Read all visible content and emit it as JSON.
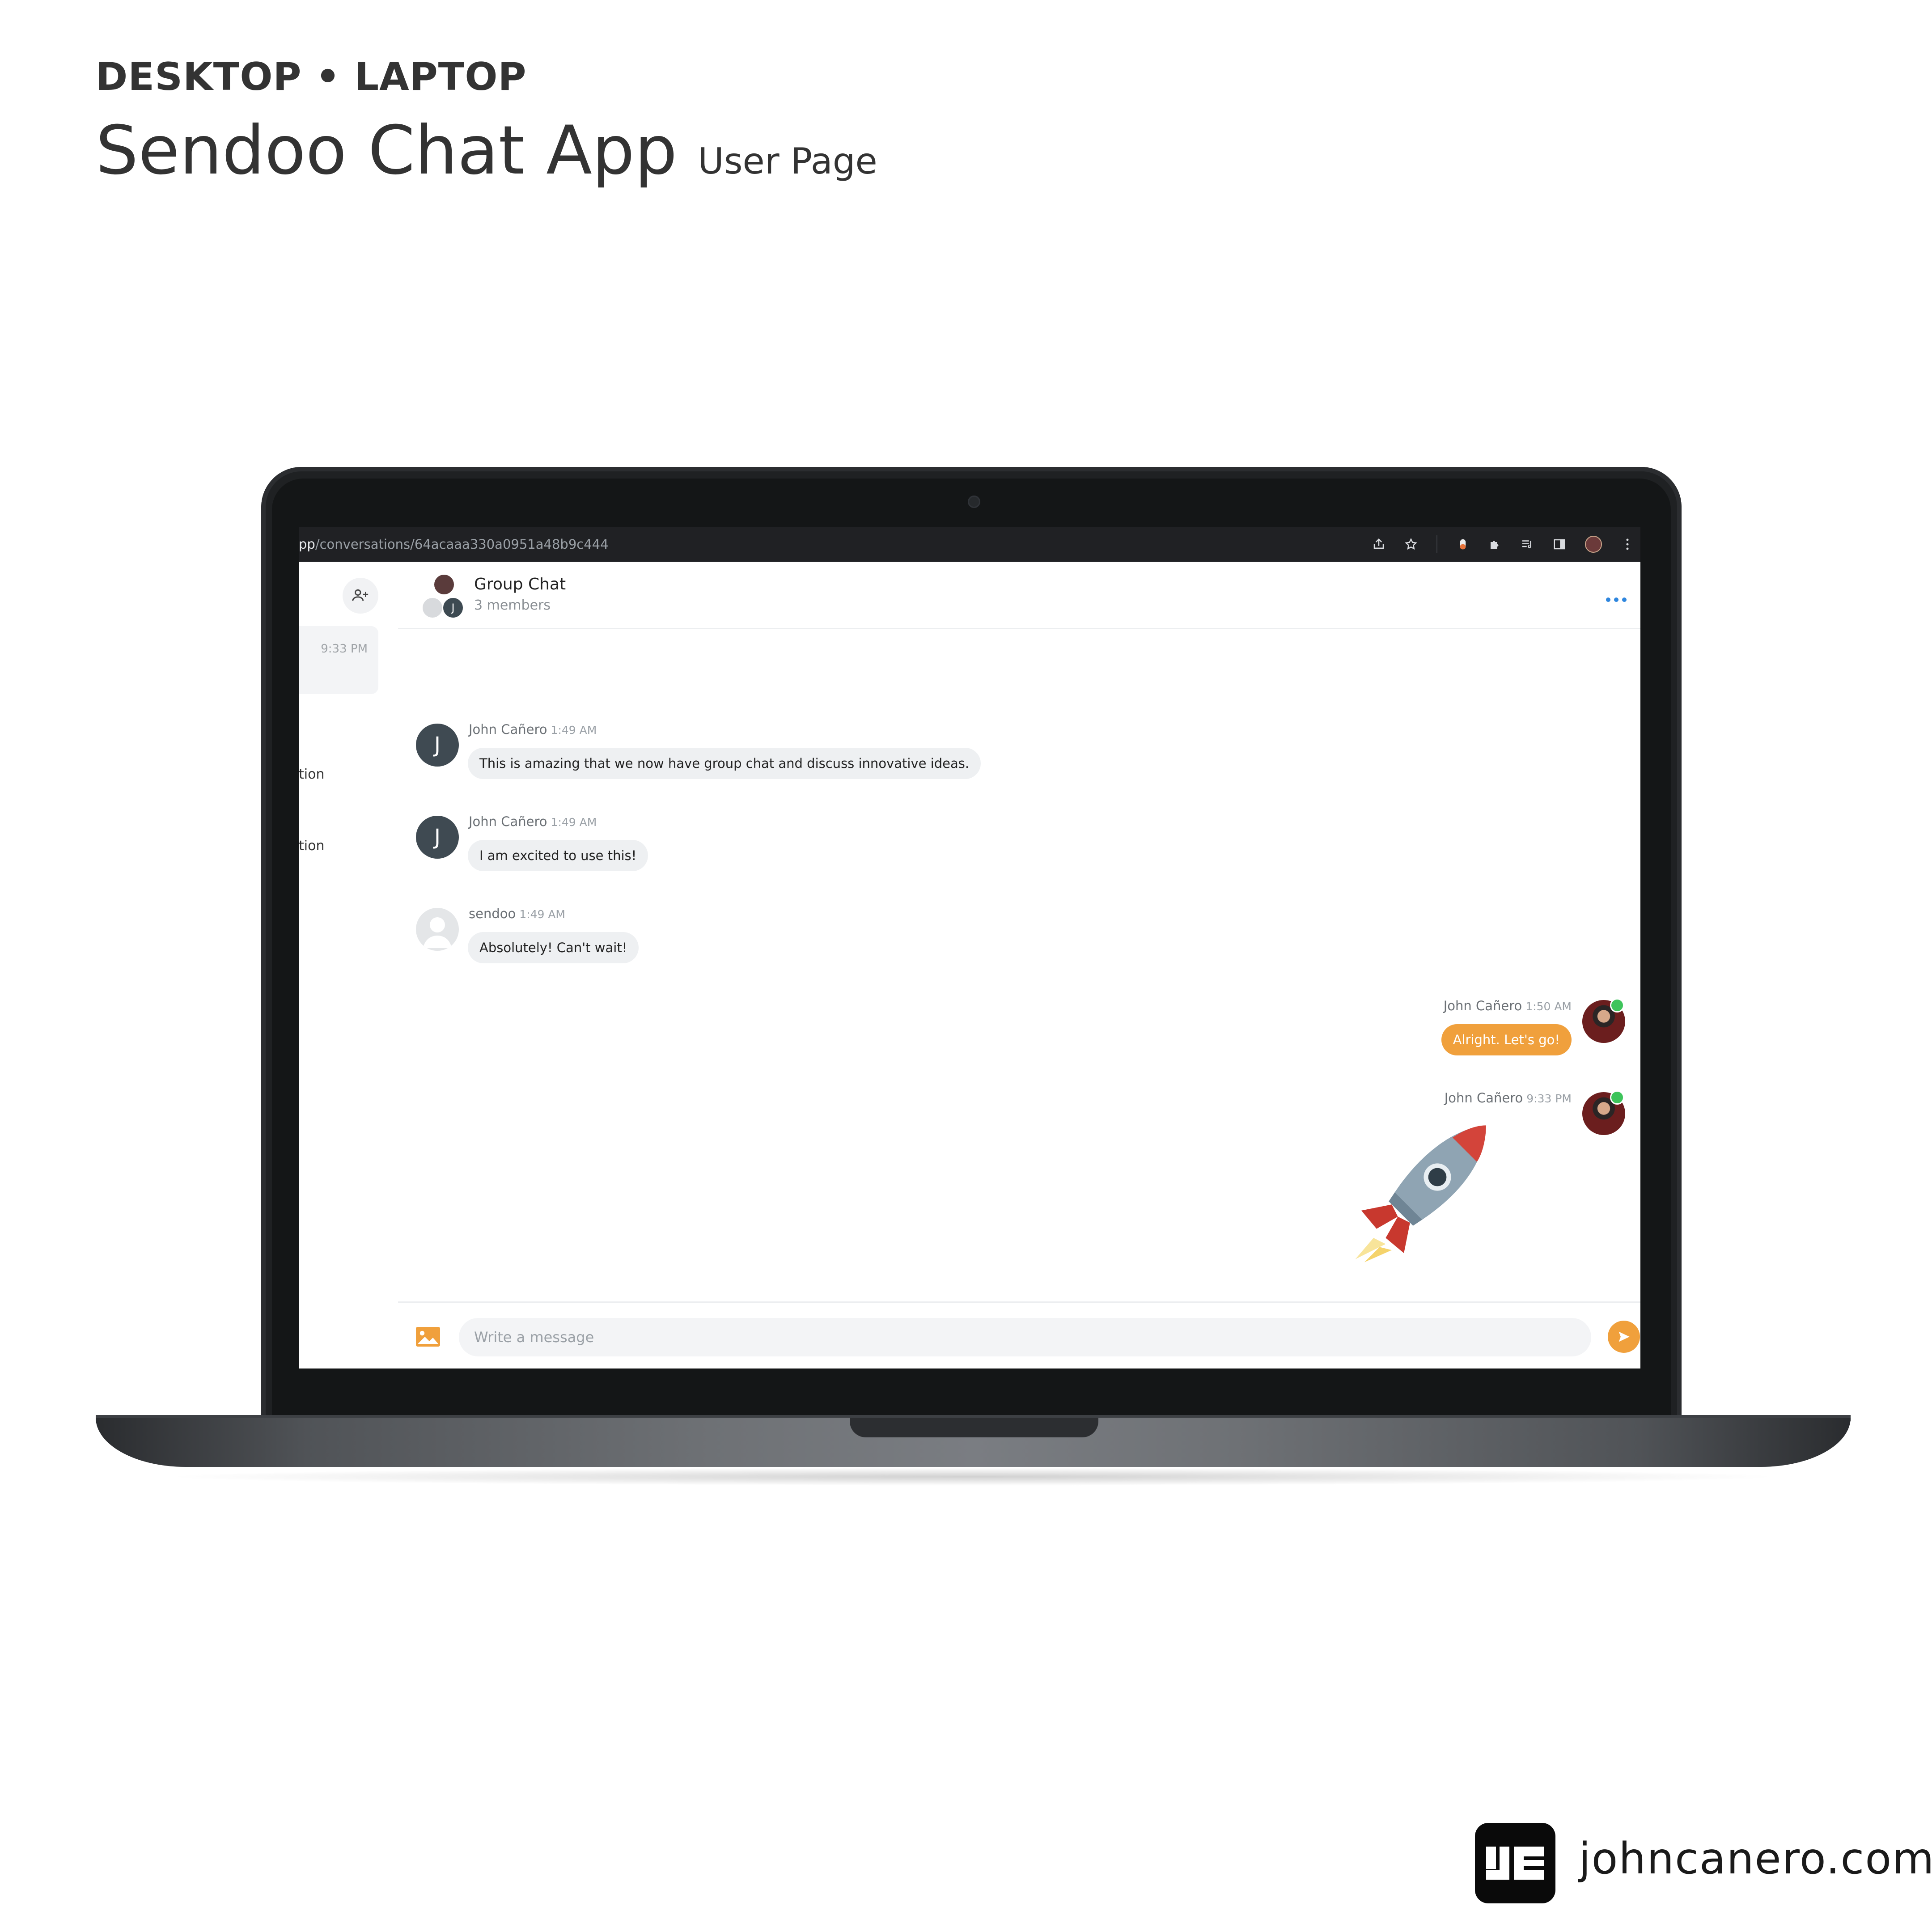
{
  "heading": {
    "kicker": "DESKTOP • LAPTOP",
    "title": "Sendoo Chat App",
    "subtitle": "User Page"
  },
  "browser": {
    "url_host": "pp",
    "url_path": "/conversations/64acaaa330a0951a48b9c444",
    "icons": [
      "share-icon",
      "star-icon",
      "extension-icon",
      "puzzle-icon",
      "media-queue-icon",
      "side-panel-icon",
      "profile-avatar",
      "kebab-menu-icon"
    ]
  },
  "sidebar": {
    "active_time": "9:33 PM",
    "truncated_items": [
      "tion",
      "tion"
    ]
  },
  "chat": {
    "title": "Group Chat",
    "members": "3 members",
    "member_initial": "J"
  },
  "messages": [
    {
      "author": "John Cañero",
      "time": "1:49 AM",
      "text": "This is amazing that we now have group chat and discuss innovative ideas.",
      "initial": "J"
    },
    {
      "author": "John Cañero",
      "time": "1:49 AM",
      "text": "I am excited to use this!",
      "initial": "J"
    },
    {
      "author": "sendoo",
      "time": "1:49 AM",
      "text": "Absolutely! Can't wait!"
    },
    {
      "author": "John Cañero",
      "time": "1:50 AM",
      "text": "Alright. Let's go!",
      "own": true
    },
    {
      "author": "John Cañero",
      "time": "9:33 PM",
      "sticker": "🚀",
      "own": true
    }
  ],
  "composer": {
    "placeholder": "Write a message"
  },
  "colors": {
    "accent": "#f0a03c",
    "online": "#3ec45b",
    "link": "#2e86de"
  },
  "footer": {
    "site": "johncanero.com"
  }
}
